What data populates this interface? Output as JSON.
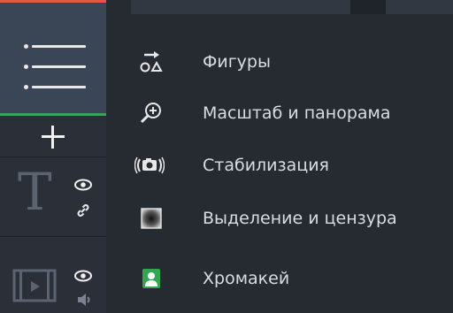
{
  "menu": {
    "items": [
      {
        "label": "Фигуры",
        "icon": "shapes-icon"
      },
      {
        "label": "Масштаб и панорама",
        "icon": "zoom-pan-icon"
      },
      {
        "label": "Стабилизация",
        "icon": "stabilization-icon"
      },
      {
        "label": "Выделение и цензура",
        "icon": "highlight-censor-icon"
      },
      {
        "label": "Хромакей",
        "icon": "chroma-key-icon"
      }
    ]
  },
  "colors": {
    "accent_top": "#e2594a",
    "accent_green": "#3aa35a",
    "chroma_green": "#2fa84f",
    "text": "#d9dde2"
  }
}
